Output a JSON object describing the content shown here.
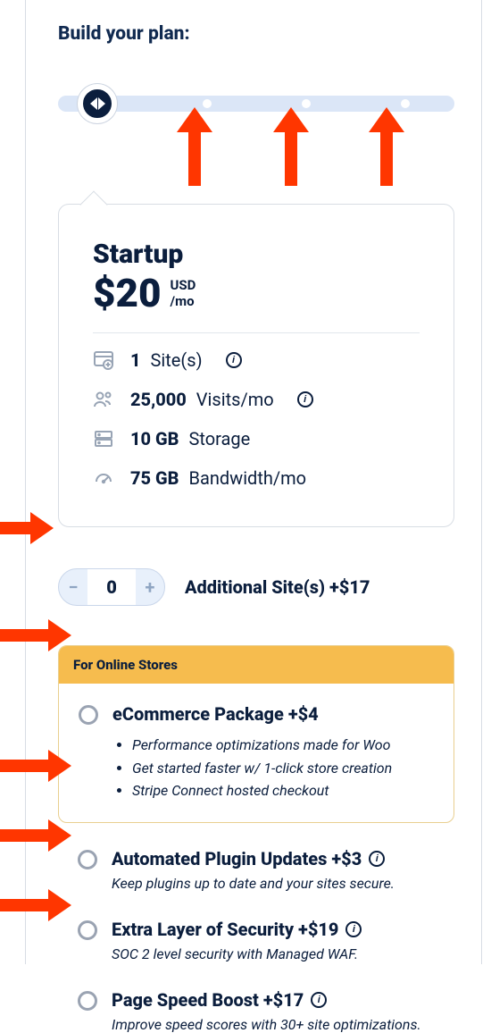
{
  "heading": "Build your plan:",
  "slider": {
    "stops": 4
  },
  "plan": {
    "name": "Startup",
    "price": "$20",
    "currency": "USD",
    "period": "/mo",
    "specs": [
      {
        "value": "1",
        "unit": "Site(s)",
        "info": true,
        "icon": "browser-add"
      },
      {
        "value": "25,000",
        "unit": "Visits/mo",
        "info": true,
        "icon": "users"
      },
      {
        "value": "10 GB",
        "unit": "Storage",
        "info": false,
        "icon": "server"
      },
      {
        "value": "75 GB",
        "unit": "Bandwidth/mo",
        "info": false,
        "icon": "gauge"
      }
    ]
  },
  "additional_sites": {
    "count": "0",
    "label": "Additional Site(s) +$17",
    "minus": "−",
    "plus": "+"
  },
  "ecommerce": {
    "banner": "For Online Stores",
    "title": "eCommerce Package +$4",
    "bullets": [
      "Performance optimizations made for Woo",
      "Get started faster w/ 1-click store creation",
      "Stripe Connect hosted checkout"
    ]
  },
  "addons": [
    {
      "title": "Automated Plugin Updates +$3",
      "desc": "Keep plugins up to date and your sites secure.",
      "info": true
    },
    {
      "title": "Extra Layer of Security +$19",
      "desc": "SOC 2 level security with Managed WAF.",
      "info": true
    },
    {
      "title": "Page Speed Boost +$17",
      "desc": "Improve speed scores with 30+ site optimizations.",
      "info": true
    }
  ]
}
